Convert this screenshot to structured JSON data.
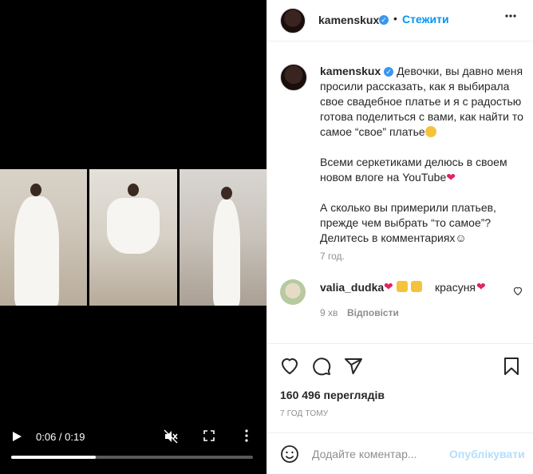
{
  "video": {
    "time_current": "0:06",
    "time_total": "0:19",
    "time_display": "0:06 / 0:19",
    "progress_fraction": 0.35
  },
  "header": {
    "username": "kamenskux",
    "follow_label": "Стежити",
    "more_label": "⋮"
  },
  "caption": {
    "username": "kamenskux",
    "paragraph1": "Девочки, вы давно меня просили рассказать, как я выбирала свое свадебное платье и я с радостью готова поделиться с вами, как найти то самое “свое” платье",
    "paragraph2": "Всеми серкетиками делюсь в своем новом влоге на YouTube",
    "paragraph3": "А сколько вы примерили платьев, прежде чем выбрать “то самое”? Делитесь в комментариях☺",
    "time_ago": "7 год."
  },
  "comment": {
    "username": "valia_dudka",
    "text": "красуня",
    "time_ago": "9 хв",
    "reply_label": "Відповісти"
  },
  "stats": {
    "views": "160 496 переглядів",
    "date": "7 ГОД ТОМУ"
  },
  "comment_input": {
    "placeholder": "Додайте коментар...",
    "publish_label": "Опублікувати"
  },
  "colors": {
    "accent": "#0095f6",
    "verified": "#3897f0",
    "publish_disabled": "#b2dffc",
    "muted": "#8e8e8e",
    "heart": "#e0245e"
  },
  "icons": [
    "play-icon",
    "mute-icon",
    "fullscreen-icon",
    "more-vertical-icon",
    "heart-icon",
    "comment-icon",
    "share-icon",
    "bookmark-icon",
    "emoji-icon",
    "verified-icon",
    "more-horizontal-icon"
  ]
}
